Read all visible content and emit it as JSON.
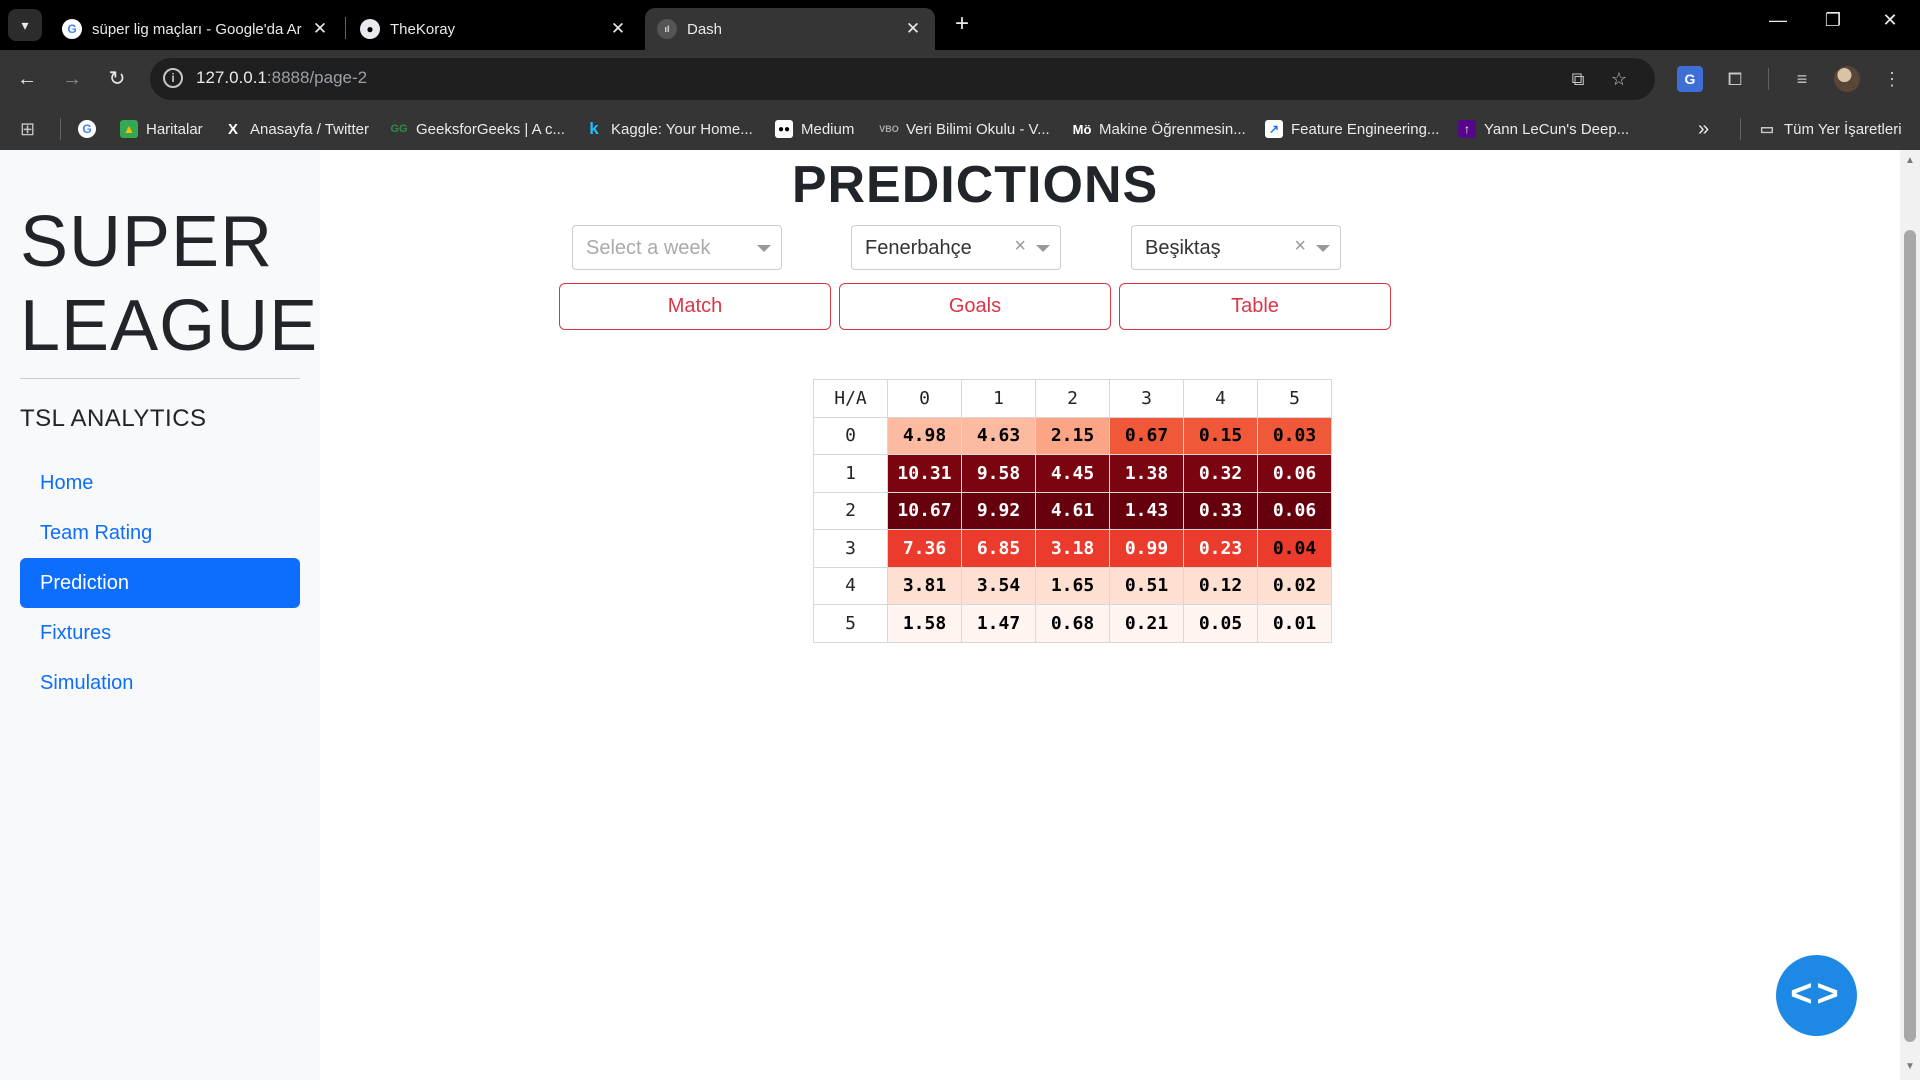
{
  "browser": {
    "tabs": [
      {
        "title": "süper lig maçları - Google'da Ar",
        "favicon": "google-icon"
      },
      {
        "title": "TheKoray",
        "favicon": "github-icon"
      },
      {
        "title": "Dash",
        "favicon": "dash-icon",
        "active": true
      }
    ],
    "url_host": "127.0.0.1",
    "url_path": ":8888/page-2",
    "bookmarks": [
      {
        "label": "Haritalar",
        "icon": "maps-icon"
      },
      {
        "label": "Anasayfa / Twitter",
        "icon": "x-icon"
      },
      {
        "label": "GeeksforGeeks | A c...",
        "icon": "gfg-icon"
      },
      {
        "label": "Kaggle: Your Home...",
        "icon": "kaggle-icon"
      },
      {
        "label": "Medium",
        "icon": "medium-icon"
      },
      {
        "label": "Veri Bilimi Okulu - V...",
        "icon": "vbo-icon"
      },
      {
        "label": "Makine Öğrenmesin...",
        "icon": "mo-icon"
      },
      {
        "label": "Feature Engineering...",
        "icon": "chart-icon"
      },
      {
        "label": "Yann LeCun's Deep...",
        "icon": "nyu-icon"
      }
    ],
    "all_bookmarks": "Tüm Yer İşaretleri",
    "more_bookmarks": "»"
  },
  "sidebar": {
    "brand_line1": "SUPER",
    "brand_line2": "LEAGUE",
    "lead": "TSL ANALYTICS",
    "nav": [
      {
        "label": "Home"
      },
      {
        "label": "Team Rating"
      },
      {
        "label": "Prediction",
        "active": true
      },
      {
        "label": "Fixtures"
      },
      {
        "label": "Simulation"
      }
    ]
  },
  "main": {
    "title": "PREDICTIONS",
    "week_placeholder": "Select a week",
    "home_team": "Fenerbahçe",
    "away_team": "Beşiktaş",
    "buttons": {
      "match": "Match",
      "goals": "Goals",
      "table": "Table"
    },
    "table": {
      "corner": "H/A",
      "col_headers": [
        "0",
        "1",
        "2",
        "3",
        "4",
        "5"
      ],
      "row_headers": [
        "0",
        "1",
        "2",
        "3",
        "4",
        "5"
      ],
      "values": [
        [
          "4.98",
          "4.63",
          "2.15",
          "0.67",
          "0.15",
          "0.03"
        ],
        [
          "10.31",
          "9.58",
          "4.45",
          "1.38",
          "0.32",
          "0.06"
        ],
        [
          "10.67",
          "9.92",
          "4.61",
          "1.43",
          "0.33",
          "0.06"
        ],
        [
          "7.36",
          "6.85",
          "3.18",
          "0.99",
          "0.23",
          "0.04"
        ],
        [
          "3.81",
          "3.54",
          "1.65",
          "0.51",
          "0.12",
          "0.02"
        ],
        [
          "1.58",
          "1.47",
          "0.68",
          "0.21",
          "0.05",
          "0.01"
        ]
      ],
      "cell_colors": [
        [
          "#fcbba1",
          "#fcbba1",
          "#fca486",
          "#f0583a",
          "#f0583a",
          "#f0583a"
        ],
        [
          "#7a0510",
          "#7a0510",
          "#7a0510",
          "#7a0510",
          "#7a0510",
          "#7a0510"
        ],
        [
          "#67000d",
          "#67000d",
          "#67000d",
          "#67000d",
          "#67000d",
          "#67000d"
        ],
        [
          "#ea3b2c",
          "#ea3b2c",
          "#ea3b2c",
          "#ea3b2c",
          "#ea3b2c",
          "#ea3b2c"
        ],
        [
          "#fee0d2",
          "#fee0d2",
          "#fee0d2",
          "#fee0d2",
          "#fee0d2",
          "#fee0d2"
        ],
        [
          "#fff5f0",
          "#fff5f0",
          "#fff5f0",
          "#fff5f0",
          "#fff5f0",
          "#fff5f0"
        ]
      ],
      "text_colors": [
        [
          "#000000",
          "#000000",
          "#000000",
          "#000000",
          "#000000",
          "#000000"
        ],
        [
          "#ffffff",
          "#ffffff",
          "#ffffff",
          "#ffffff",
          "#ffffff",
          "#ffffff"
        ],
        [
          "#ffffff",
          "#ffffff",
          "#ffffff",
          "#ffffff",
          "#ffffff",
          "#ffffff"
        ],
        [
          "#ffffff",
          "#ffffff",
          "#ffffff",
          "#ffffff",
          "#ffffff",
          "#000000"
        ],
        [
          "#000000",
          "#000000",
          "#000000",
          "#000000",
          "#000000",
          "#000000"
        ],
        [
          "#000000",
          "#000000",
          "#000000",
          "#000000",
          "#000000",
          "#000000"
        ]
      ]
    },
    "fab_icon": "code-brackets-icon",
    "fab_label": "<>"
  },
  "colors": {
    "accent": "#0d6efd",
    "danger": "#dc3545",
    "fab": "#1e88e5"
  }
}
